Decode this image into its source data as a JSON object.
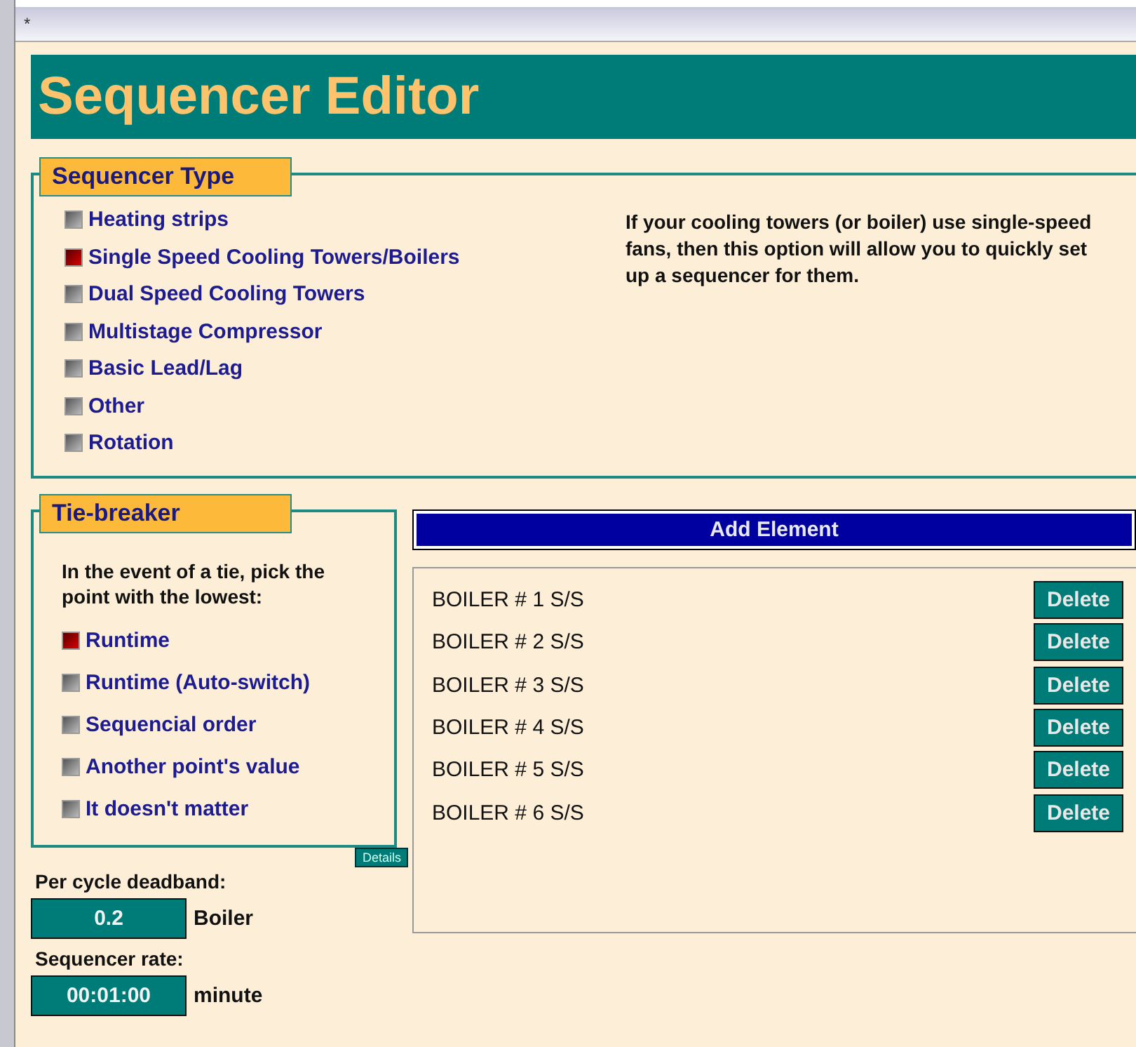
{
  "window": {
    "title": "*"
  },
  "header": {
    "title": "Sequencer Editor"
  },
  "sequencer_type": {
    "legend": "Sequencer Type",
    "options": [
      {
        "label": "Heating strips",
        "selected": false
      },
      {
        "label": "Single Speed Cooling Towers/Boilers",
        "selected": true
      },
      {
        "label": "Dual Speed Cooling Towers",
        "selected": false
      },
      {
        "label": "Multistage Compressor",
        "selected": false
      },
      {
        "label": "Basic Lead/Lag",
        "selected": false
      },
      {
        "label": "Other",
        "selected": false
      },
      {
        "label": "Rotation",
        "selected": false
      }
    ],
    "description": "If your cooling towers (or boiler) use single-speed fans, then this option will allow you to quickly set up a sequencer for them."
  },
  "tie_breaker": {
    "legend": "Tie-breaker",
    "prompt": "In the event of a tie, pick the point with the lowest:",
    "options": [
      {
        "label": "Runtime",
        "selected": true
      },
      {
        "label": "Runtime (Auto-switch)",
        "selected": false
      },
      {
        "label": "Sequencial order",
        "selected": false
      },
      {
        "label": "Another point's value",
        "selected": false
      },
      {
        "label": "It doesn't matter",
        "selected": false
      }
    ],
    "details_button": "Details"
  },
  "deadband": {
    "label": "Per cycle deadband:",
    "value": "0.2",
    "unit": "Boiler"
  },
  "rate": {
    "label": "Sequencer rate:",
    "value": "00:01:00",
    "unit": "minute"
  },
  "elements": {
    "add_button": "Add Element",
    "items": [
      {
        "name": "BOILER # 1 S/S",
        "action": "Delete"
      },
      {
        "name": "BOILER # 2 S/S",
        "action": "Delete"
      },
      {
        "name": "BOILER # 3 S/S",
        "action": "Delete"
      },
      {
        "name": "BOILER # 4 S/S",
        "action": "Delete"
      },
      {
        "name": "BOILER # 5 S/S",
        "action": "Delete"
      },
      {
        "name": "BOILER # 6 S/S",
        "action": "Delete"
      }
    ]
  }
}
